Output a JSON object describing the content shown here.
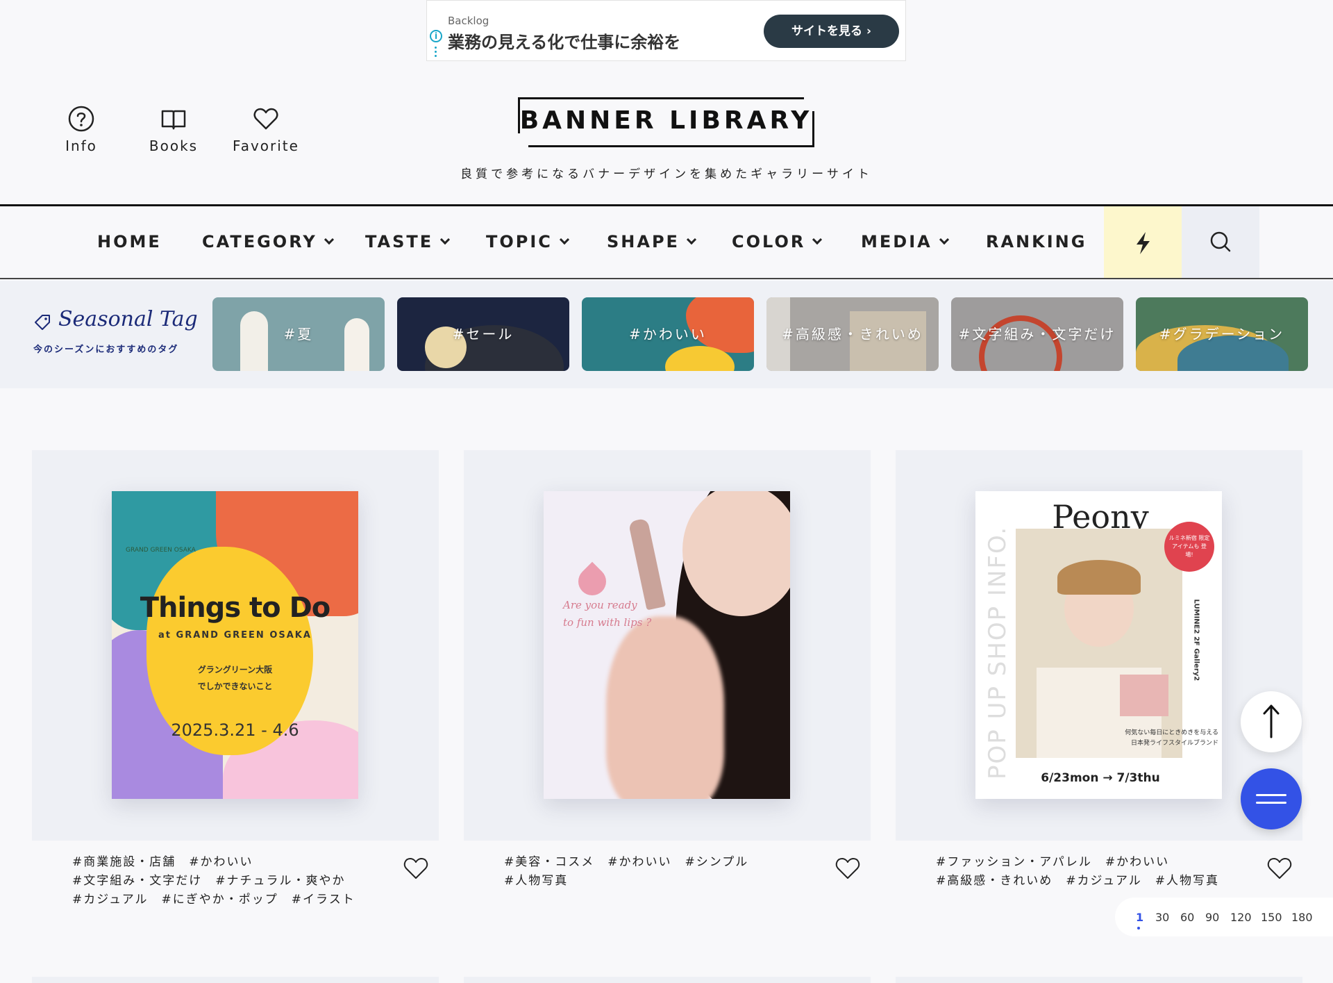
{
  "ad": {
    "sponsor": "Backlog",
    "text": "業務の見える化で仕事に余裕を",
    "cta": "サイトを見る ›"
  },
  "header": {
    "icons": [
      {
        "label": "Info",
        "icon": "question-circle-icon"
      },
      {
        "label": "Books",
        "icon": "book-icon"
      },
      {
        "label": "Favorite",
        "icon": "heart-icon"
      }
    ],
    "logo": "BANNER LIBRARY",
    "tagline": "良質で参考になるバナーデザインを集めたギャラリーサイト"
  },
  "nav": {
    "items": [
      {
        "label": "HOME",
        "dropdown": false
      },
      {
        "label": "CATEGORY",
        "dropdown": true
      },
      {
        "label": "TASTE",
        "dropdown": true
      },
      {
        "label": "TOPIC",
        "dropdown": true
      },
      {
        "label": "SHAPE",
        "dropdown": true
      },
      {
        "label": "COLOR",
        "dropdown": true
      },
      {
        "label": "MEDIA",
        "dropdown": true
      },
      {
        "label": "RANKING",
        "dropdown": false
      }
    ],
    "flash_icon": "lightning-icon",
    "search_icon": "search-icon"
  },
  "seasonal": {
    "title": "Seasonal Tag",
    "subtitle": "今のシーズンにおすすめのタグ",
    "tags": [
      {
        "label": "#夏",
        "color": "#7fa3a8"
      },
      {
        "label": "#セール",
        "color": "#1c2540"
      },
      {
        "label": "#かわいい",
        "color": "#2c7d85"
      },
      {
        "label": "#高級感・きれいめ",
        "color": "#a8a5a2"
      },
      {
        "label": "#文字組み・文字だけ",
        "color": "#9e9c9c"
      },
      {
        "label": "#グラデーション",
        "color": "#4d7a5c"
      }
    ]
  },
  "cards": [
    {
      "tags_line1": "#商業施設・店舗　#かわいい",
      "tags_line2": "#文字組み・文字だけ　#ナチュラル・爽やか",
      "tags_line3": "#カジュアル　#にぎやか・ポップ　#イラスト",
      "banner": {
        "brand": "GRAND GREEN OSAKA",
        "title": "Things to Do",
        "sub": "at GRAND GREEN OSAKA",
        "jp1": "グラングリーン大阪",
        "jp2": "でしかできないこと",
        "date": "2025.3.21 - 4.6"
      }
    },
    {
      "tags_line1": "#美容・コスメ　#かわいい　#シンプル",
      "tags_line2": "#人物写真",
      "tags_line3": "",
      "banner": {
        "copy1": "Are you ready",
        "copy2": "to fun with lips ?"
      }
    },
    {
      "tags_line1": "#ファッション・アパレル　#かわいい",
      "tags_line2": "#高級感・きれいめ　#カジュアル　#人物写真",
      "tags_line3": "",
      "banner": {
        "side": "POP UP SHOP INFO.",
        "brand": "Peony",
        "badge": "ルミネ新宿 限定アイテムも 登場!",
        "place": "LUMINE2 2F Gallery2",
        "small1": "何気ない毎日にときめきを与える",
        "small2": "日本発ライフスタイルブランド",
        "date": "6/23mon → 7/3thu"
      }
    }
  ],
  "pager": {
    "options": [
      "1",
      "30",
      "60",
      "90",
      "120",
      "150",
      "180"
    ],
    "selected": "1"
  },
  "floating": {
    "up_icon": "arrow-up-icon",
    "menu_icon": "menu-icon"
  }
}
